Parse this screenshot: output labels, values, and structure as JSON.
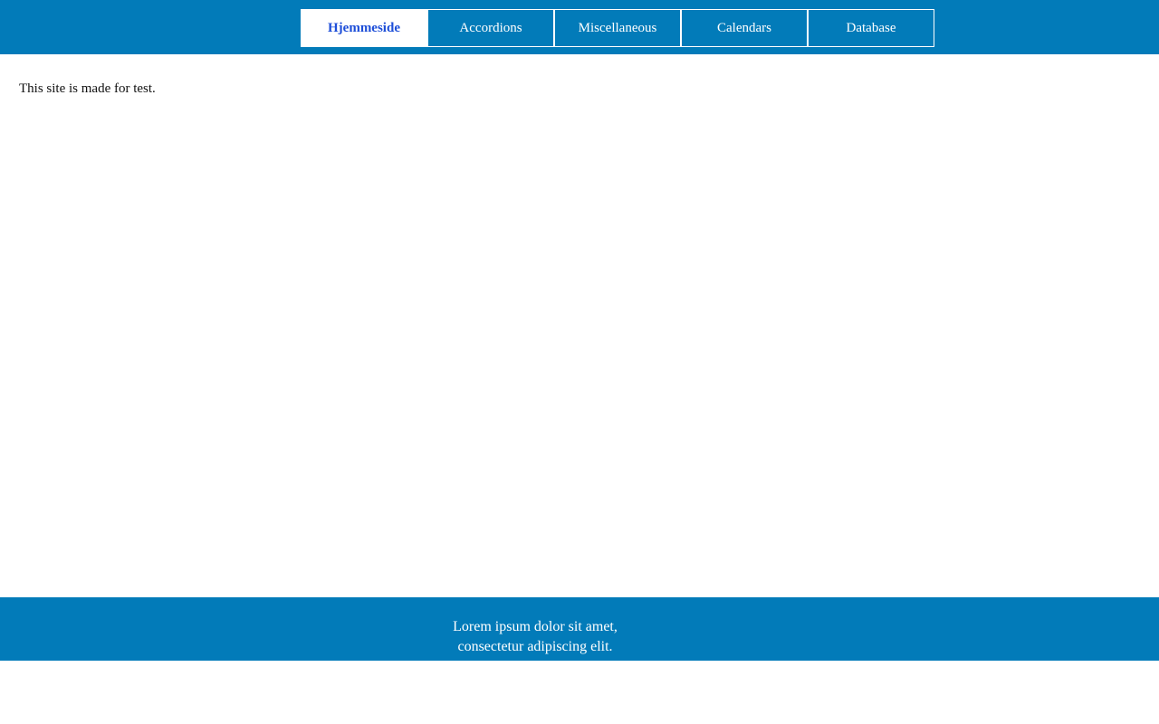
{
  "nav": {
    "items": [
      {
        "label": "Hjemmeside",
        "active": true
      },
      {
        "label": "Accordions",
        "active": false
      },
      {
        "label": "Miscellaneous",
        "active": false
      },
      {
        "label": "Calendars",
        "active": false
      },
      {
        "label": "Database",
        "active": false
      }
    ]
  },
  "main": {
    "text": "This site is made for test."
  },
  "footer": {
    "line1": "Lorem ipsum dolor sit amet,",
    "line2": "consectetur adipiscing elit."
  },
  "colors": {
    "header_bg": "#027bb9",
    "footer_bg": "#027bb9",
    "active_text": "#1d4ed8"
  }
}
